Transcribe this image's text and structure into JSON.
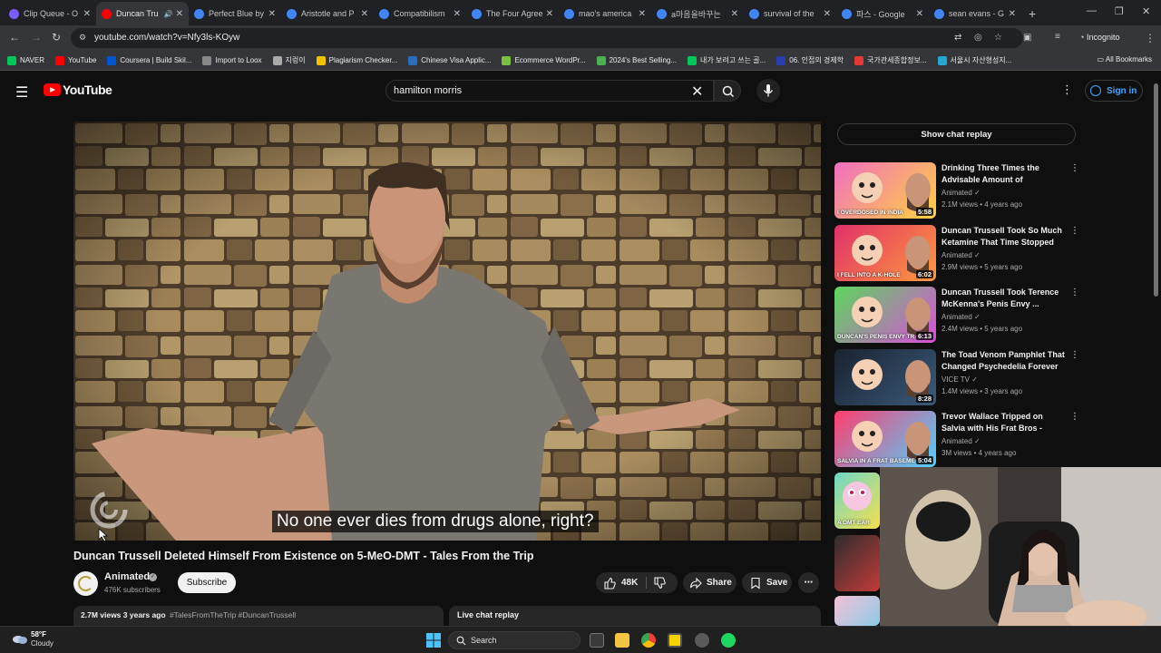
{
  "browser": {
    "tabs": [
      {
        "title": "Clip Queue - O",
        "color": "#7b5cff",
        "active": false
      },
      {
        "title": "Duncan Tru",
        "color": "#ff0000",
        "active": true,
        "audio": true
      },
      {
        "title": "Perfect Blue by",
        "color": "#4285f4",
        "active": false
      },
      {
        "title": "Aristotle and P",
        "color": "#4285f4",
        "active": false
      },
      {
        "title": "Compatibilism",
        "color": "#4285f4",
        "active": false
      },
      {
        "title": "The Four Agree",
        "color": "#4285f4",
        "active": false
      },
      {
        "title": "mao's america",
        "color": "#4285f4",
        "active": false
      },
      {
        "title": "a마음을바꾸는",
        "color": "#4285f4",
        "active": false
      },
      {
        "title": "survival of the",
        "color": "#4285f4",
        "active": false
      },
      {
        "title": "파스 - Google",
        "color": "#4285f4",
        "active": false
      },
      {
        "title": "sean evans - G",
        "color": "#4285f4",
        "active": false
      }
    ],
    "url": "youtube.com/watch?v=Nfy3ls-KOyw",
    "incognito_label": "Incognito",
    "bookmarks": [
      {
        "label": "NAVER",
        "color": "#03c75a"
      },
      {
        "label": "YouTube",
        "color": "#ff0000"
      },
      {
        "label": "Coursera | Build Skil...",
        "color": "#0056d2"
      },
      {
        "label": "Import to Loox",
        "color": "#888888"
      },
      {
        "label": "지렁이",
        "color": "#aaaaaa"
      },
      {
        "label": "Plagiarism Checker...",
        "color": "#f2c200"
      },
      {
        "label": "Chinese Visa Applic...",
        "color": "#2a6ebb"
      },
      {
        "label": "Ecommerce WordPr...",
        "color": "#7ac142"
      },
      {
        "label": "2024's Best Selling...",
        "color": "#4caf50"
      },
      {
        "label": "내가 보려고 쓰는 골...",
        "color": "#03c75a"
      },
      {
        "label": "06. 인접의 경제학",
        "color": "#2a3eb1"
      },
      {
        "label": "국가관세종합정보...",
        "color": "#e53935"
      },
      {
        "label": "서울시 자산형성지...",
        "color": "#26a6d1"
      }
    ],
    "all_bookmarks_label": "All Bookmarks"
  },
  "youtube": {
    "logo_text": "YouTube",
    "search_value": "hamilton morris",
    "sign_in_label": "Sign in",
    "caption": "No one ever dies from drugs alone, right?",
    "video_title": "Duncan Trussell Deleted Himself From Existence on 5-MeO-DMT - Tales From the Trip",
    "channel": {
      "name": "Animated",
      "subscribers": "476K subscribers"
    },
    "subscribe_label": "Subscribe",
    "likes": "48K",
    "share_label": "Share",
    "save_label": "Save",
    "description_meta": "2.7M views  3 years ago",
    "description_tags": "#TalesFromTheTrip #DuncanTrussell",
    "live_chat_label": "Live chat replay",
    "show_chat_replay_label": "Show chat replay",
    "recommendations": [
      {
        "title": "Drinking Three Times the Advisable Amount of Marijuan...",
        "channel": "Animated",
        "meta": "2.1M views • 4 years ago",
        "duration": "5:58",
        "overlay": "I OVERDOSED IN INDIA",
        "bg1": "#f06ec0",
        "bg2": "#ffd23f"
      },
      {
        "title": "Duncan Trussell Took So Much Ketamine That Time Stopped -...",
        "channel": "Animated",
        "meta": "2.9M views • 5 years ago",
        "duration": "6:02",
        "overlay": "I FELL INTO A K-HOLE",
        "bg1": "#e0306a",
        "bg2": "#ff9a3c"
      },
      {
        "title": "Duncan Trussell Took Terence McKenna's Penis Envy ...",
        "channel": "Animated",
        "meta": "2.4M views • 5 years ago",
        "duration": "6:13",
        "overlay": "DUNCAN'S PENIS ENVY TR",
        "bg1": "#5cd65c",
        "bg2": "#d94fd9"
      },
      {
        "title": "The Toad Venom Pamphlet That Changed Psychedelia Forever ...",
        "channel": "VICE TV",
        "meta": "1.4M views • 3 years ago",
        "duration": "8:28",
        "overlay": "",
        "bg1": "#1a2230",
        "bg2": "#3a5a7a"
      },
      {
        "title": "Trevor Wallace Tripped on Salvia with His Frat Bros - Tale...",
        "channel": "Animated",
        "meta": "3M views • 4 years ago",
        "duration": "5:04",
        "overlay": "SALVIA IN A FRAT BASEME",
        "bg1": "#ff3d6e",
        "bg2": "#4fd1ff"
      }
    ],
    "partial_overlay": "A DMT EAR"
  },
  "taskbar": {
    "weather_temp": "58°F",
    "weather_desc": "Cloudy",
    "search_label": "Search"
  }
}
